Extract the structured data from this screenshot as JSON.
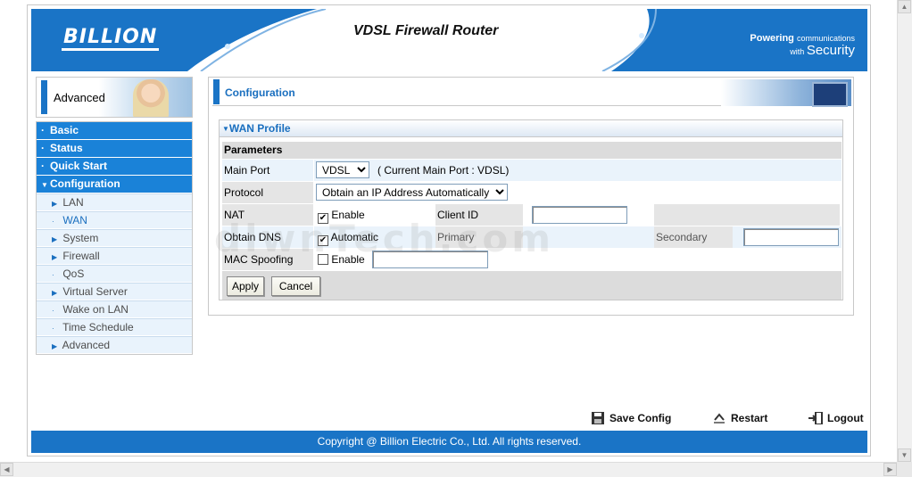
{
  "brand": {
    "logo_text": "BILLION",
    "product_title": "VDSL Firewall Router",
    "tagline_1": "Powering",
    "tagline_1_small": "communications",
    "tagline_2": "with",
    "tagline_2_big": "Security",
    "accent_color": "#1a74c6"
  },
  "sidebar": {
    "header_label": "Advanced",
    "main_items": [
      {
        "label": "Basic",
        "icon": "bullet-icon"
      },
      {
        "label": "Status",
        "icon": "bullet-icon"
      },
      {
        "label": "Quick Start",
        "icon": "bullet-icon"
      },
      {
        "label": "Configuration",
        "icon": "triangle-down-icon"
      }
    ],
    "sub_items": [
      {
        "label": "LAN",
        "icon": "triangle-right-icon"
      },
      {
        "label": "WAN",
        "icon": "bullet-icon",
        "active": true
      },
      {
        "label": "System",
        "icon": "triangle-right-icon"
      },
      {
        "label": "Firewall",
        "icon": "triangle-right-icon"
      },
      {
        "label": "QoS",
        "icon": "bullet-icon"
      },
      {
        "label": "Virtual Server",
        "icon": "triangle-right-icon"
      },
      {
        "label": "Wake on LAN",
        "icon": "bullet-icon"
      },
      {
        "label": "Time Schedule",
        "icon": "bullet-icon"
      },
      {
        "label": "Advanced",
        "icon": "triangle-right-icon"
      }
    ]
  },
  "content": {
    "page_title": "Configuration",
    "section_title": "WAN Profile",
    "params_title": "Parameters",
    "main_port": {
      "label": "Main Port",
      "value": "VDSL",
      "note": "( Current Main Port : VDSL)"
    },
    "protocol": {
      "label": "Protocol",
      "value": "Obtain an IP Address Automatically"
    },
    "nat": {
      "label": "NAT",
      "checkbox_label": "Enable",
      "checked": true,
      "client_id_label": "Client ID",
      "client_id_value": ""
    },
    "obtain_dns": {
      "label": "Obtain DNS",
      "checkbox_label": "Automatic",
      "checked": true,
      "primary_label": "Primary",
      "secondary_label": "Secondary",
      "secondary_value": ""
    },
    "mac_spoofing": {
      "label": "MAC Spoofing",
      "checkbox_label": "Enable",
      "checked": false,
      "value": ""
    },
    "apply_label": "Apply",
    "cancel_label": "Cancel"
  },
  "watermark": "dlwnTech.com",
  "footer": {
    "save_config": "Save Config",
    "restart": "Restart",
    "logout": "Logout",
    "copyright": "Copyright @ Billion Electric Co., Ltd. All rights reserved."
  }
}
